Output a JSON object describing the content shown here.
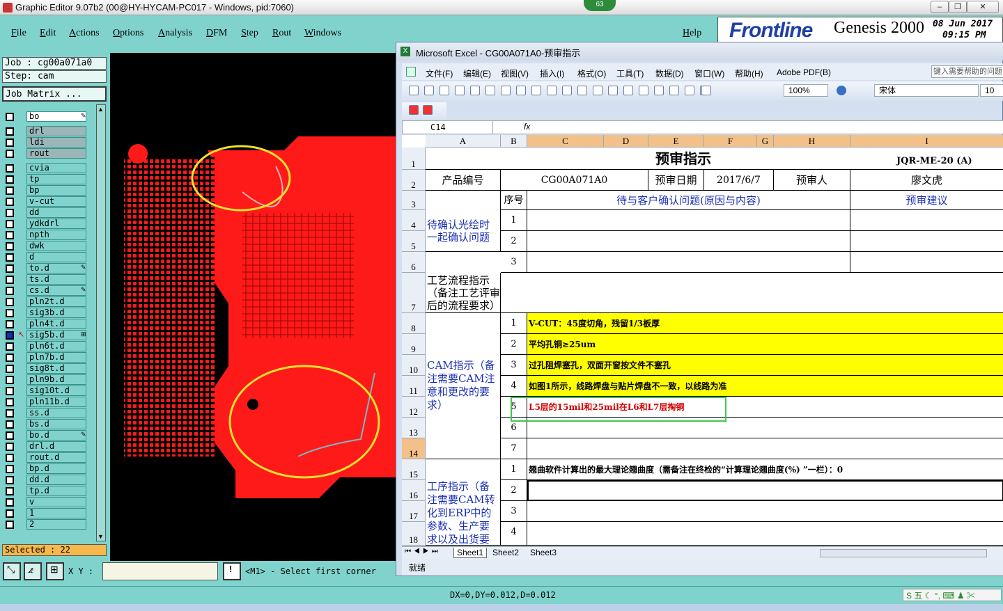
{
  "genesis": {
    "window_title": "Graphic Editor 9.07b2 (00@HY-HYCAM-PC017 - Windows, pid:7060)",
    "badge": "63",
    "menu": [
      "File",
      "Edit",
      "Actions",
      "Options",
      "Analysis",
      "DFM",
      "Step",
      "Rout",
      "Windows"
    ],
    "help": "Help",
    "brand_logo": "Frontline",
    "product": "Genesis 2000",
    "date": "08 Jun 2017",
    "time": "09:15 PM",
    "job": "Job : cg00a071a0",
    "step": "Step: cam",
    "job_matrix": "Job Matrix ...",
    "layers": [
      "bo",
      "drl",
      "ldi",
      "rout",
      "cvia",
      "tp",
      "bp",
      "v-cut",
      "dd",
      "ydkdrl",
      "npth",
      "dwk",
      "d",
      "to.d",
      "ts.d",
      "cs.d",
      "pln2t.d",
      "sig3b.d",
      "pln4t.d",
      "sig5b.d",
      "pln6t.d",
      "pln7b.d",
      "sig8t.d",
      "pln9b.d",
      "sig10t.d",
      "pln11b.d",
      "ss.d",
      "bs.d",
      "bo.d",
      "drl.d",
      "rout.d",
      "bp.d",
      "dd.d",
      "tp.d",
      "v",
      "1",
      "2"
    ],
    "selected": "Selected : 22",
    "xy_label": "X Y :",
    "xy_value": "",
    "prompt": "<M1> - Select first corner",
    "measure": "DX=0,DY=0.012,D=0.012"
  },
  "excel": {
    "window_title": "Microsoft Excel - CG00A071A0-预审指示",
    "menu": [
      "文件(F)",
      "编辑(E)",
      "视图(V)",
      "插入(I)",
      "格式(O)",
      "工具(T)",
      "数据(D)",
      "窗口(W)",
      "帮助(H)",
      "Adobe PDF(B)"
    ],
    "help_placeholder": "键入需要帮助的问题",
    "zoom": "100%",
    "font": "宋体",
    "font_size": "10",
    "name_box": "C14",
    "fx": "fx",
    "columns": [
      "A",
      "B",
      "C",
      "D",
      "E",
      "F",
      "G",
      "H",
      "I"
    ],
    "rows": [
      "1",
      "2",
      "3",
      "4",
      "5",
      "6",
      "7",
      "8",
      "9",
      "10",
      "11",
      "12",
      "13",
      "14",
      "15",
      "16",
      "17",
      "18"
    ],
    "title": "预审指示",
    "doc_code": "JQR-ME-20 (A)",
    "product_no_label": "产品编号",
    "product_no": "CG00A071A0",
    "review_date_label": "预审日期",
    "review_date": "2017/6/7",
    "reviewer_label": "预审人",
    "reviewer": "廖文虎",
    "seq_label": "序号",
    "issues_header": "待与客户确认问题(原因与内容)",
    "advice_header": "预审建议",
    "confirm_section": "待确认光绘时一起确认问题",
    "process_section": "工艺流程指示（备注工艺评审后的流程要求）",
    "cam_section": "CAM指示（备注需要CAM注意和更改的要求）",
    "work_section": "工序指示（备注需要CAM转化到ERP中的参数、生产要求以及出货要",
    "cam_items": [
      {
        "no": "1",
        "text": "V-CUT：45度切角，残留1/3板厚"
      },
      {
        "no": "2",
        "text": "平均孔铜≥25um"
      },
      {
        "no": "3",
        "text": "过孔阻焊塞孔，双面开窗按文件不塞孔"
      },
      {
        "no": "4",
        "text": "如图1所示，线路焊盘与贴片焊盘不一致，以线路为准"
      },
      {
        "no": "5",
        "text": "L5层的15mil和25mil在L6和L7层掏铜"
      },
      {
        "no": "6",
        "text": ""
      },
      {
        "no": "7",
        "text": ""
      }
    ],
    "work_items": [
      {
        "no": "1",
        "text": "翘曲软件计算出的最大理论翘曲度（需备注在终检的“计算理论翘曲度(%) ”一栏）：0"
      },
      {
        "no": "2",
        "text": ""
      },
      {
        "no": "3",
        "text": ""
      },
      {
        "no": "4",
        "text": ""
      }
    ],
    "confirm_numbers": [
      "1",
      "2",
      "3"
    ],
    "sheets": [
      "Sheet1",
      "Sheet2",
      "Sheet3"
    ],
    "status": "就绪"
  },
  "colors": {
    "teal": "#7fd3cc",
    "board_red": "#ff1a1a",
    "highlight_yellow": "#ffff00",
    "circle": "#f0e030",
    "note_green": "#3cc84a"
  }
}
